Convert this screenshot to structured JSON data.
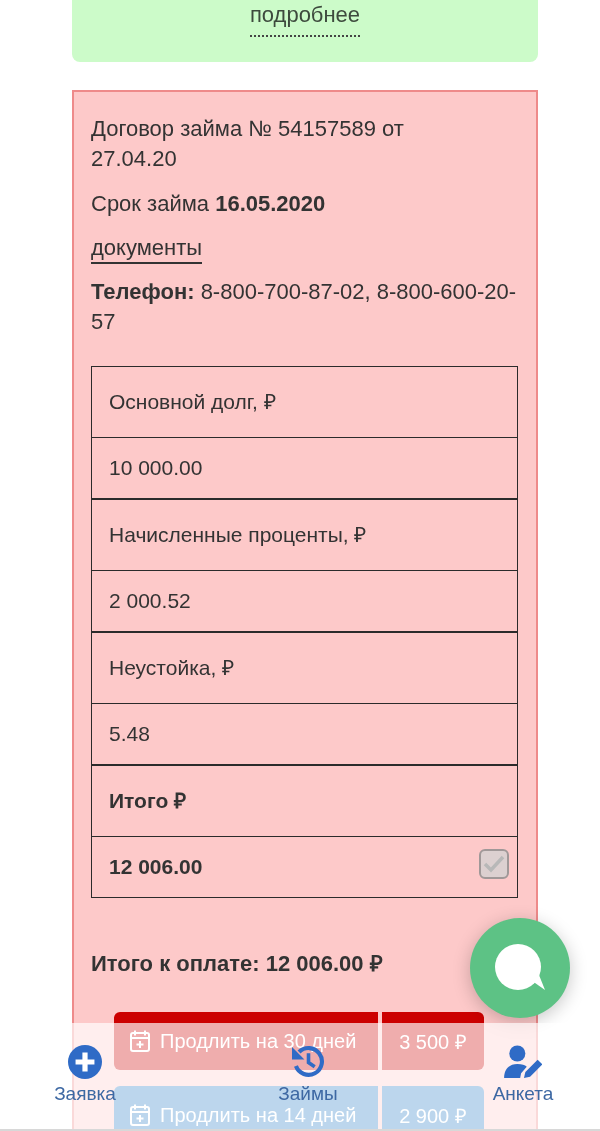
{
  "notice": {
    "link": "подробнее"
  },
  "loan": {
    "contract": "Договор займа № 54157589 от 27.04.20",
    "term": "Срок займа **16.05.2020**",
    "documents_link": "документы",
    "phone": "**Телефон:** 8-800-700-87-02, 8-800-600-20-57",
    "table": {
      "rows": [
        {
          "kind": "item",
          "label": "Основной долг, ₽",
          "value": "10 000.00"
        },
        {
          "kind": "item",
          "label": "Начисленные проценты, ₽",
          "value": "2 000.52"
        },
        {
          "kind": "item",
          "label": "Неустойка, ₽",
          "value": "5.48"
        },
        {
          "kind": "total",
          "label": "Итого ₽",
          "value": "12 006.00",
          "checkbox": {
            "checked": true,
            "disabled": true
          }
        }
      ]
    },
    "total_due": "Итого к оплате: 12 006.00 ₽",
    "actions": [
      {
        "kind": "primary",
        "label": "Продлить на 30 дней",
        "price": "3 500 ₽"
      },
      {
        "kind": "secondary",
        "label": "Продлить на 14 дней",
        "price": "2 900 ₽"
      }
    ]
  },
  "bottom_nav": {
    "items": [
      {
        "label": "Заявка"
      },
      {
        "label": "Займы"
      },
      {
        "label": "Анкета"
      }
    ]
  }
}
